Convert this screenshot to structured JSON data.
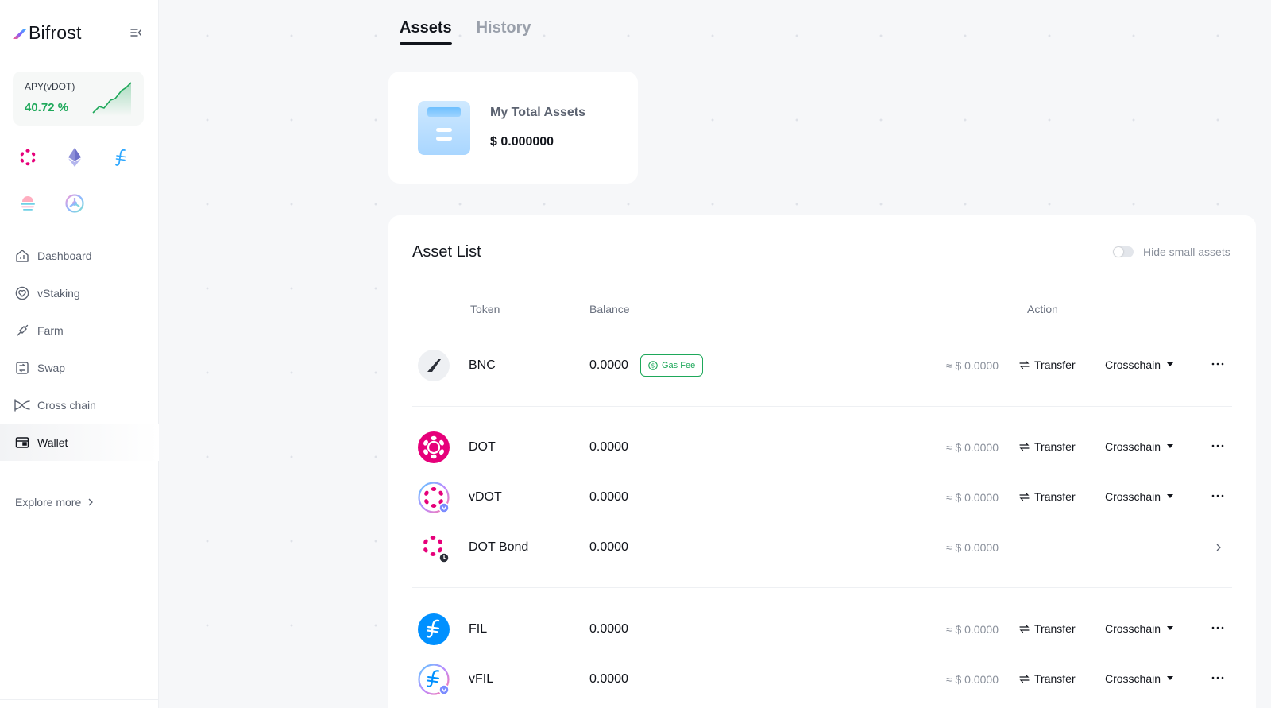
{
  "brand": {
    "name": "Bifrost"
  },
  "apy": {
    "label": "APY(vDOT)",
    "value": "40.72 %",
    "accent_color": "#1ea85a"
  },
  "chains": [
    {
      "name": "polkadot-icon"
    },
    {
      "name": "ethereum-icon"
    },
    {
      "name": "filecoin-icon"
    },
    {
      "name": "moonriver-icon"
    },
    {
      "name": "kusama-icon"
    }
  ],
  "nav": {
    "items": [
      {
        "label": "Dashboard",
        "icon": "home-icon"
      },
      {
        "label": "vStaking",
        "icon": "heart-icon"
      },
      {
        "label": "Farm",
        "icon": "shovel-icon"
      },
      {
        "label": "Swap",
        "icon": "swap-icon"
      },
      {
        "label": "Cross chain",
        "icon": "cross-chain-icon"
      },
      {
        "label": "Wallet",
        "icon": "wallet-icon",
        "active": true
      }
    ],
    "explore": "Explore more"
  },
  "tabs": [
    {
      "label": "Assets",
      "active": true
    },
    {
      "label": "History",
      "active": false
    }
  ],
  "total": {
    "label": "My Total Assets",
    "value": "$ 0.000000"
  },
  "asset_list": {
    "title": "Asset List",
    "hide_small_label": "Hide small assets",
    "hide_small_enabled": false,
    "columns": {
      "token": "Token",
      "balance": "Balance",
      "action": "Action"
    },
    "transfer_label": "Transfer",
    "crosschain_label": "Crosschain",
    "gas_fee_label": "Gas Fee",
    "rows": [
      {
        "token": "BNC",
        "balance": "0.0000",
        "usd": "≈ $ 0.0000",
        "gas_fee": true,
        "actions": true
      },
      {
        "token": "DOT",
        "balance": "0.0000",
        "usd": "≈ $ 0.0000",
        "actions": true
      },
      {
        "token": "vDOT",
        "balance": "0.0000",
        "usd": "≈ $ 0.0000",
        "actions": true
      },
      {
        "token": "DOT Bond",
        "balance": "0.0000",
        "usd": "≈ $ 0.0000",
        "actions": false
      },
      {
        "token": "FIL",
        "balance": "0.0000",
        "usd": "≈ $ 0.0000",
        "actions": true
      },
      {
        "token": "vFIL",
        "balance": "0.0000",
        "usd": "≈ $ 0.0000",
        "actions": true
      }
    ]
  },
  "colors": {
    "dot_pink": "#e6007a",
    "fil_blue": "#0090ff",
    "green": "#1ea85a"
  }
}
